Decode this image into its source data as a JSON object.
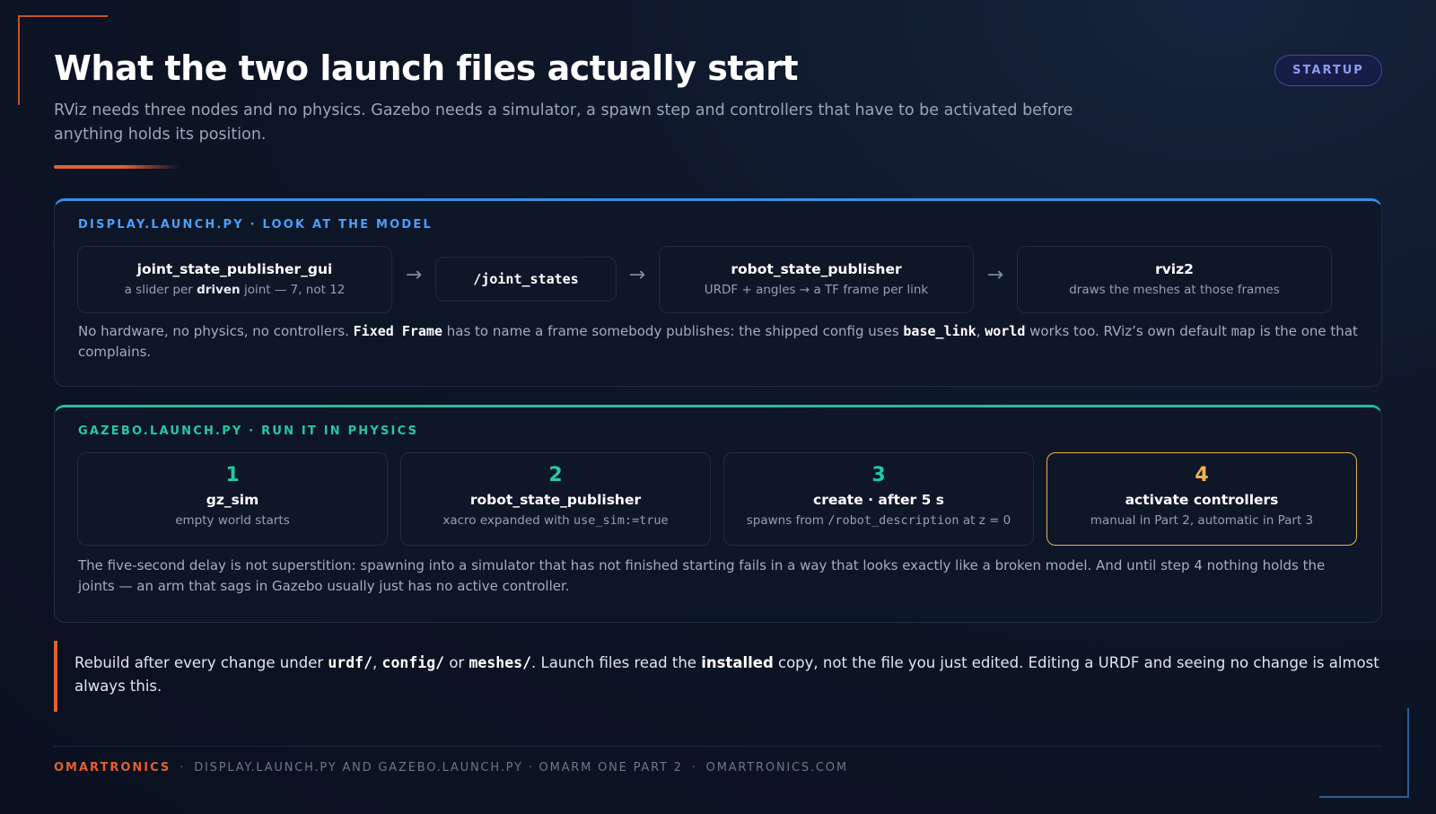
{
  "title": "What the two launch files actually start",
  "badge": "STARTUP",
  "subtitle": "RViz needs three nodes and no physics. Gazebo needs a simulator, a spawn step and controllers that have to be activated before anything holds its position.",
  "display": {
    "label": "DISPLAY.LAUNCH.PY · LOOK AT THE MODEL",
    "nodes": [
      {
        "title": "joint_state_publisher_gui",
        "sub_a": "a slider per ",
        "sub_b": "driven",
        "sub_c": " joint — 7, not 12"
      },
      {
        "title": "/joint_states"
      },
      {
        "title": "robot_state_publisher",
        "sub": "URDF + angles → a TF frame per link"
      },
      {
        "title": "rviz2",
        "sub": "draws the meshes at those frames"
      }
    ],
    "arrow": "→",
    "note": {
      "t1": "No hardware, no physics, no controllers. ",
      "m1": "Fixed Frame",
      "t2": " has to name a frame somebody publishes: the shipped config uses ",
      "m2": "base_link",
      "t3": ", ",
      "m3": "world",
      "t4": " works too. RViz’s own default ",
      "m4": "map",
      "t5": " is the one that complains."
    }
  },
  "gazebo": {
    "label": "GAZEBO.LAUNCH.PY · RUN IT IN PHYSICS",
    "steps": [
      {
        "num": "1",
        "title": "gz_sim",
        "sub": "empty world starts"
      },
      {
        "num": "2",
        "title": "robot_state_publisher",
        "sub_a": "xacro expanded with ",
        "sub_m": "use_sim:=true",
        "sub_b": ""
      },
      {
        "num": "3",
        "title": "create · after 5 s",
        "sub_a": "spawns from ",
        "sub_m": "/robot_description",
        "sub_b": " at z = 0"
      },
      {
        "num": "4",
        "title": "activate controllers",
        "sub": "manual in Part 2, automatic in Part 3"
      }
    ],
    "note": "The five-second delay is not superstition: spawning into a simulator that has not finished starting fails in a way that looks exactly like a broken model. And until step 4 nothing holds the joints — an arm that sags in Gazebo usually just has no active controller."
  },
  "callout": {
    "t1": "Rebuild after every change under ",
    "m1": "urdf/",
    "t2": ", ",
    "m2": "config/",
    "t3": " or ",
    "m3": "meshes/",
    "t4": ". Launch files read the ",
    "b1": "installed",
    "t5": " copy, not the file you just edited. Editing a URDF and seeing no change is almost always this."
  },
  "footer": {
    "brand": "OMARTRONICS",
    "sep": "·",
    "text": "DISPLAY.LAUNCH.PY AND GAZEBO.LAUNCH.PY · OMARM ONE PART 2",
    "site": "OMARTRONICS.COM"
  },
  "colors": {
    "accent_orange": "#e3602d",
    "display_blue": "#3b8fe6",
    "gazebo_green": "#1fbf99",
    "active_amber": "#e8b04a",
    "badge_purple": "#8f9cf0"
  }
}
